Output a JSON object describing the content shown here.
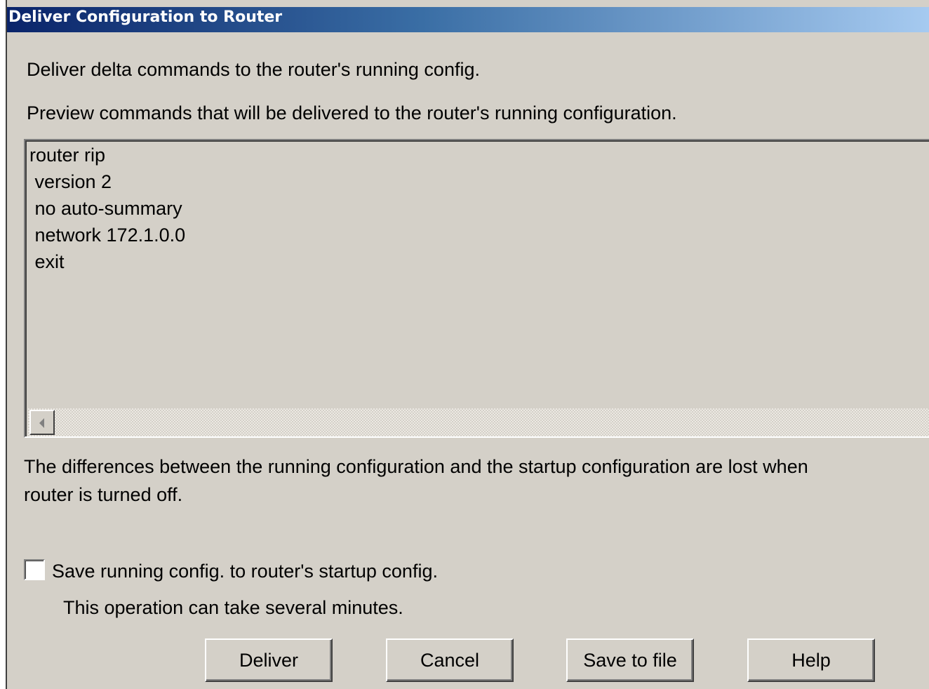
{
  "window": {
    "title": "Deliver Configuration to Router"
  },
  "intro": {
    "line1": "Deliver delta commands to the router's running config.",
    "line2": "Preview commands that will be delivered to the router's running configuration."
  },
  "preview": {
    "commands": [
      "router rip",
      " version 2",
      " no auto-summary",
      " network 172.1.0.0",
      " exit"
    ]
  },
  "notice": {
    "line1": "The differences between the running configuration and the startup configuration are lost when",
    "line2": "router is turned off."
  },
  "save_option": {
    "checked": false,
    "label": "Save running config. to router's startup config.",
    "hint": "This operation can take several minutes."
  },
  "buttons": {
    "deliver": "Deliver",
    "cancel": "Cancel",
    "save_to_file": "Save to file",
    "help": "Help"
  },
  "colors": {
    "dialog_background": "#d4d0c8",
    "titlebar_start": "#0a246a",
    "titlebar_end": "#a6caf0"
  }
}
